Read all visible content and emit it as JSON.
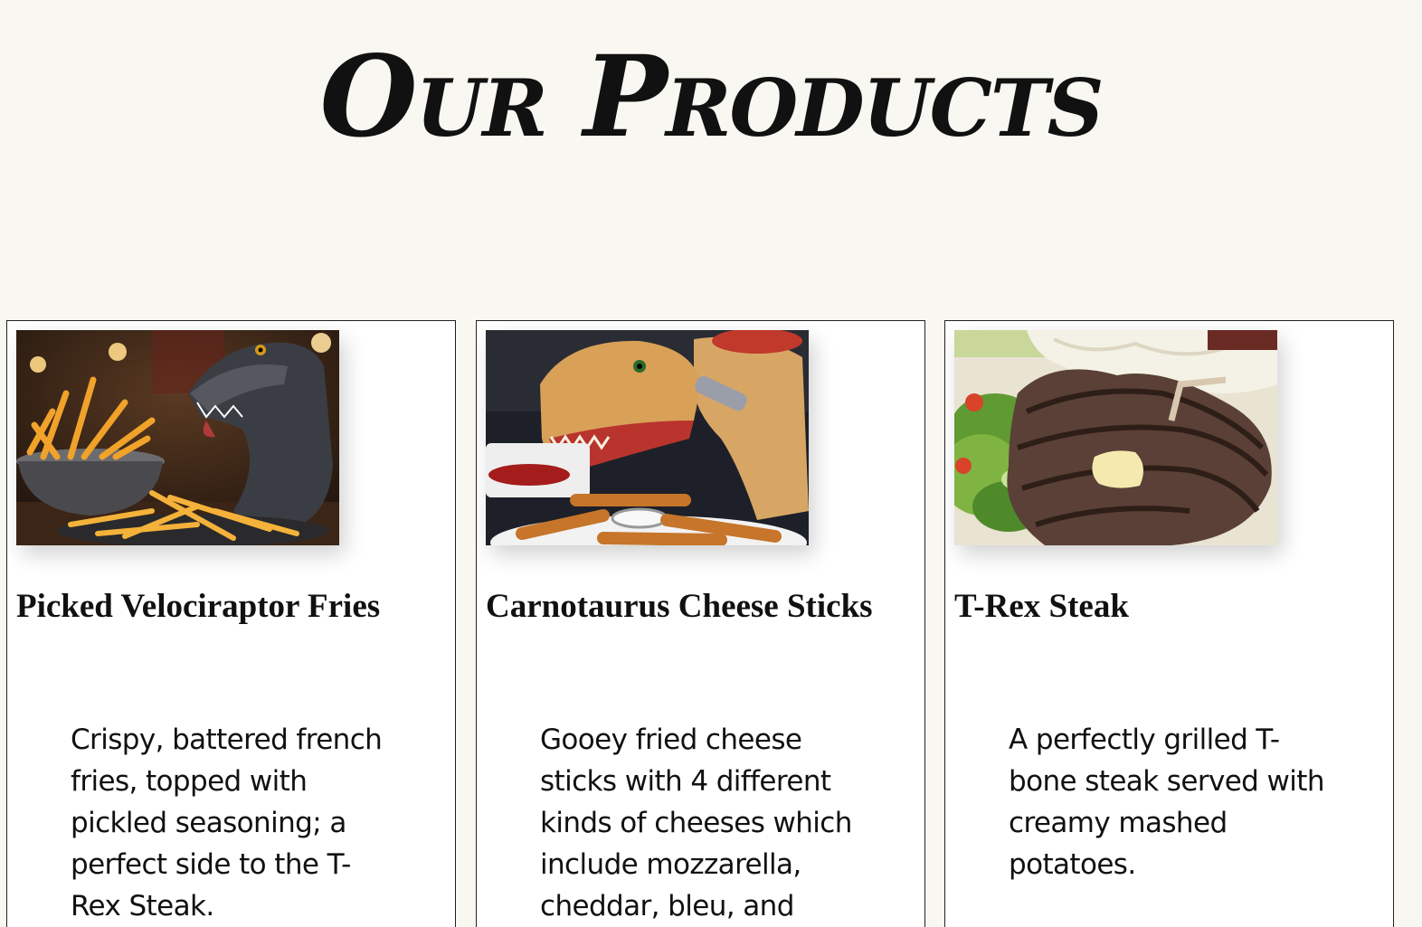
{
  "page": {
    "title": "Our Products"
  },
  "products": [
    {
      "name": "Picked Velociraptor Fries",
      "description": "Crispy, battered french fries, topped with pickled seasoning; a perfect side to the T-Rex Steak."
    },
    {
      "name": "Carnotaurus Cheese Sticks",
      "description": "Gooey fried cheese sticks with 4 different kinds of cheeses which include mozzarella, cheddar, bleu, and"
    },
    {
      "name": "T-Rex Steak",
      "description": "A perfectly grilled T-bone steak served with creamy mashed potatoes."
    }
  ]
}
